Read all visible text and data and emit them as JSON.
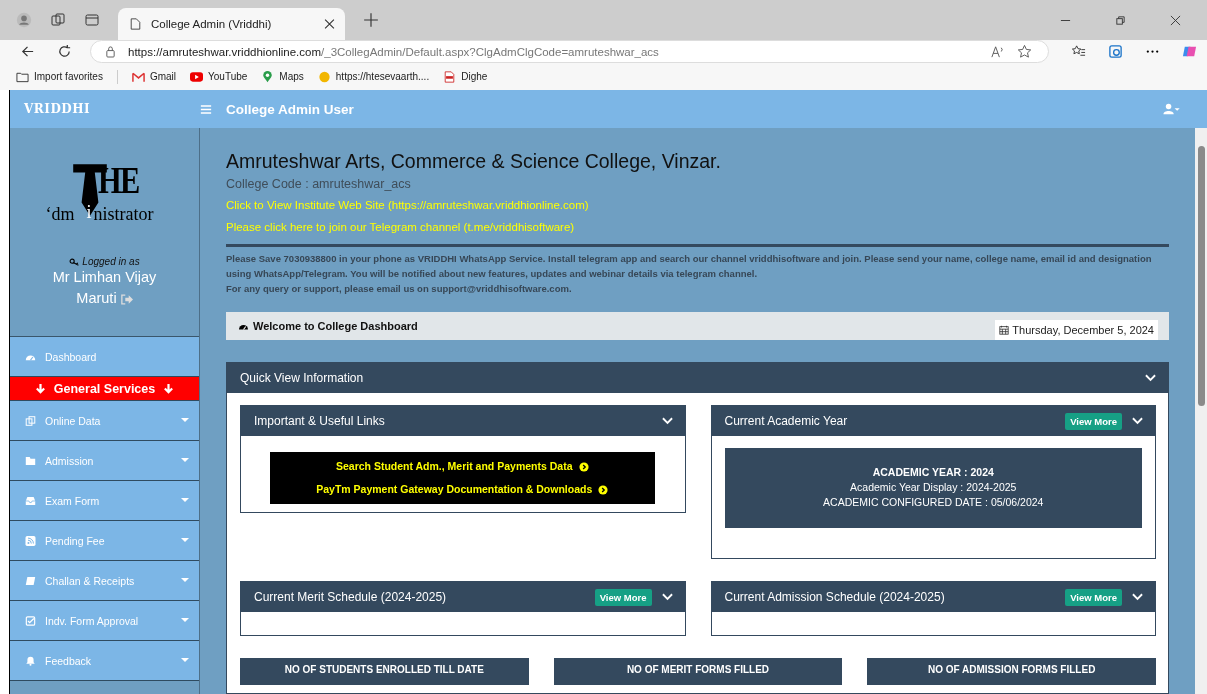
{
  "browser": {
    "tabs": [
      {
        "title": "College Admin (Vriddhi)",
        "selected": true
      }
    ],
    "address": {
      "url_host": "https://amruteshwar.vriddhionline.com",
      "url_path": "/_3CollegAdmin/Default.aspx?ClgAdmClgCode=amruteshwar_acs"
    },
    "bookmarks": [
      {
        "label": "Import favorites",
        "kind": "import"
      },
      {
        "label": "Gmail",
        "kind": "gmail"
      },
      {
        "label": "YouTube",
        "kind": "youtube"
      },
      {
        "label": "Maps",
        "kind": "maps"
      },
      {
        "label": "https://htesevaarth....",
        "kind": "site"
      },
      {
        "label": "Dighe",
        "kind": "pdf"
      }
    ]
  },
  "header": {
    "brand": "VRIDDHI",
    "title": "College Admin User"
  },
  "sidebar": {
    "logo": {
      "word_1": "HE",
      "word_2": "‘dm",
      "word_3": "i",
      "word_4": "nistrator"
    },
    "logged_in_label": "Logged in as",
    "user_name": "Mr Limhan Vijay Maruti",
    "items": [
      {
        "label": "Dashboard",
        "kind": "link"
      },
      {
        "label": "General Services",
        "kind": "section"
      },
      {
        "label": "Online Data",
        "kind": "dropdown"
      },
      {
        "label": "Admission",
        "kind": "dropdown"
      },
      {
        "label": "Exam Form",
        "kind": "dropdown"
      },
      {
        "label": "Pending Fee",
        "kind": "dropdown"
      },
      {
        "label": "Challan & Receipts",
        "kind": "dropdown"
      },
      {
        "label": "Indv. Form Approval",
        "kind": "dropdown"
      },
      {
        "label": "Feedback",
        "kind": "dropdown"
      }
    ]
  },
  "main": {
    "college_name": "Amruteshwar Arts, Commerce & Science College, Vinzar.",
    "college_code": "College Code : amruteshwar_acs",
    "links": [
      "Click to View Institute Web Site (https://amruteshwar.vriddhionline.com)",
      "Please click here to join our Telegram channel (t.me/vriddhisoftware)"
    ],
    "notice": [
      "Please Save 7030938800 in your phone as VRIDDHI WhatsApp Service. Install telegram app and search our channel vriddhisoftware and join. Please send your name, college name, email id and designation using WhatsApp/Telegram. You will be notified about new features, updates and webinar details via telegram channel.",
      "For any query or support, please email us on support@vriddhisoftware.com."
    ],
    "welcome": "Welcome to College Dashboard",
    "date": "Thursday, December 5, 2024",
    "quick_view": {
      "title": "Quick View Information",
      "panels": [
        {
          "title": "Important & Useful Links",
          "kind": "links",
          "buttons": [
            "Search Student Adm., Merit and Payments Data",
            "PayTm Payment Gateway Documentation & Downloads"
          ]
        },
        {
          "title": "Current Academic Year",
          "kind": "academic",
          "view_more": "View More",
          "heading": "ACADEMIC YEAR : 2024",
          "lines": [
            "Academic Year Display : 2024-2025",
            "ACADEMIC CONFIGURED DATE : 05/06/2024"
          ]
        },
        {
          "title": "Current Merit Schedule (2024-2025)",
          "kind": "empty",
          "view_more": "View More"
        },
        {
          "title": "Current Admission Schedule (2024-2025)",
          "kind": "empty",
          "view_more": "View More"
        }
      ],
      "stats": [
        "NO OF STUDENTS ENROLLED TILL DATE",
        "NO OF MERIT FORMS FILLED",
        "NO OF ADMISSION FORMS FILLED"
      ]
    }
  }
}
